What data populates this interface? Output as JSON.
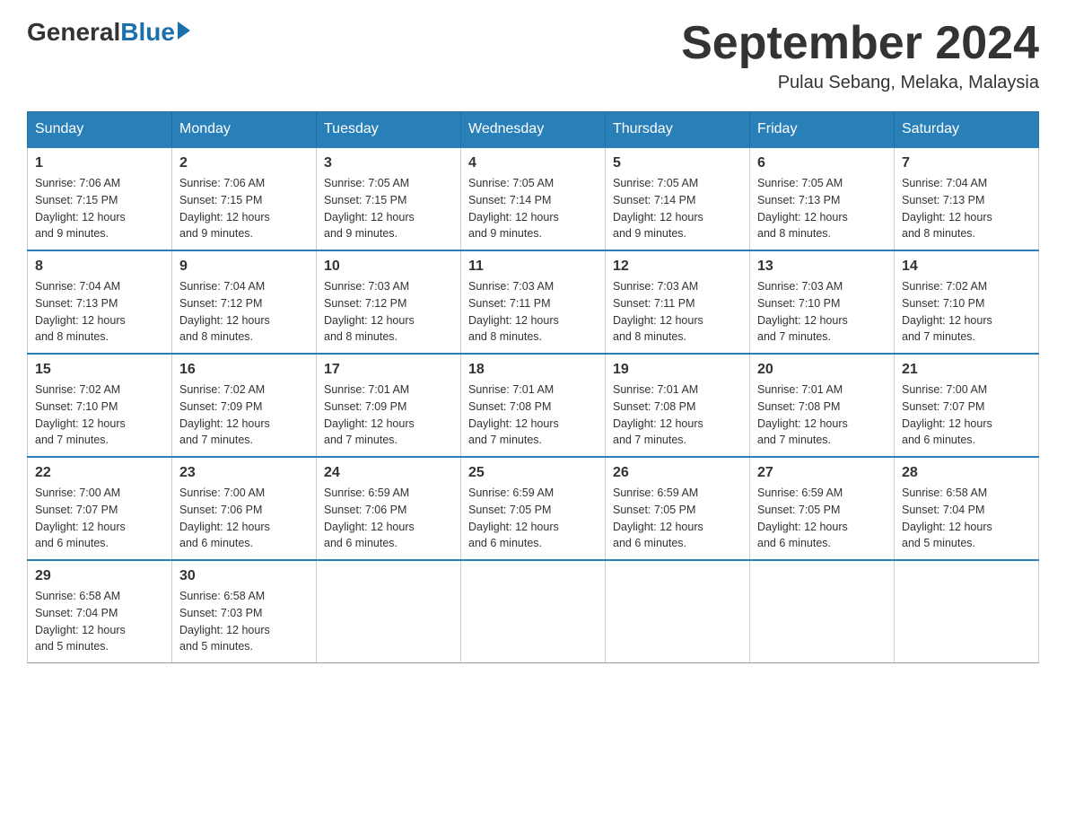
{
  "header": {
    "logo": {
      "general": "General",
      "blue": "Blue"
    },
    "title": "September 2024",
    "location": "Pulau Sebang, Melaka, Malaysia"
  },
  "days_of_week": [
    "Sunday",
    "Monday",
    "Tuesday",
    "Wednesday",
    "Thursday",
    "Friday",
    "Saturday"
  ],
  "weeks": [
    [
      {
        "day": "1",
        "sunrise": "7:06 AM",
        "sunset": "7:15 PM",
        "daylight": "12 hours and 9 minutes."
      },
      {
        "day": "2",
        "sunrise": "7:06 AM",
        "sunset": "7:15 PM",
        "daylight": "12 hours and 9 minutes."
      },
      {
        "day": "3",
        "sunrise": "7:05 AM",
        "sunset": "7:15 PM",
        "daylight": "12 hours and 9 minutes."
      },
      {
        "day": "4",
        "sunrise": "7:05 AM",
        "sunset": "7:14 PM",
        "daylight": "12 hours and 9 minutes."
      },
      {
        "day": "5",
        "sunrise": "7:05 AM",
        "sunset": "7:14 PM",
        "daylight": "12 hours and 9 minutes."
      },
      {
        "day": "6",
        "sunrise": "7:05 AM",
        "sunset": "7:13 PM",
        "daylight": "12 hours and 8 minutes."
      },
      {
        "day": "7",
        "sunrise": "7:04 AM",
        "sunset": "7:13 PM",
        "daylight": "12 hours and 8 minutes."
      }
    ],
    [
      {
        "day": "8",
        "sunrise": "7:04 AM",
        "sunset": "7:13 PM",
        "daylight": "12 hours and 8 minutes."
      },
      {
        "day": "9",
        "sunrise": "7:04 AM",
        "sunset": "7:12 PM",
        "daylight": "12 hours and 8 minutes."
      },
      {
        "day": "10",
        "sunrise": "7:03 AM",
        "sunset": "7:12 PM",
        "daylight": "12 hours and 8 minutes."
      },
      {
        "day": "11",
        "sunrise": "7:03 AM",
        "sunset": "7:11 PM",
        "daylight": "12 hours and 8 minutes."
      },
      {
        "day": "12",
        "sunrise": "7:03 AM",
        "sunset": "7:11 PM",
        "daylight": "12 hours and 8 minutes."
      },
      {
        "day": "13",
        "sunrise": "7:03 AM",
        "sunset": "7:10 PM",
        "daylight": "12 hours and 7 minutes."
      },
      {
        "day": "14",
        "sunrise": "7:02 AM",
        "sunset": "7:10 PM",
        "daylight": "12 hours and 7 minutes."
      }
    ],
    [
      {
        "day": "15",
        "sunrise": "7:02 AM",
        "sunset": "7:10 PM",
        "daylight": "12 hours and 7 minutes."
      },
      {
        "day": "16",
        "sunrise": "7:02 AM",
        "sunset": "7:09 PM",
        "daylight": "12 hours and 7 minutes."
      },
      {
        "day": "17",
        "sunrise": "7:01 AM",
        "sunset": "7:09 PM",
        "daylight": "12 hours and 7 minutes."
      },
      {
        "day": "18",
        "sunrise": "7:01 AM",
        "sunset": "7:08 PM",
        "daylight": "12 hours and 7 minutes."
      },
      {
        "day": "19",
        "sunrise": "7:01 AM",
        "sunset": "7:08 PM",
        "daylight": "12 hours and 7 minutes."
      },
      {
        "day": "20",
        "sunrise": "7:01 AM",
        "sunset": "7:08 PM",
        "daylight": "12 hours and 7 minutes."
      },
      {
        "day": "21",
        "sunrise": "7:00 AM",
        "sunset": "7:07 PM",
        "daylight": "12 hours and 6 minutes."
      }
    ],
    [
      {
        "day": "22",
        "sunrise": "7:00 AM",
        "sunset": "7:07 PM",
        "daylight": "12 hours and 6 minutes."
      },
      {
        "day": "23",
        "sunrise": "7:00 AM",
        "sunset": "7:06 PM",
        "daylight": "12 hours and 6 minutes."
      },
      {
        "day": "24",
        "sunrise": "6:59 AM",
        "sunset": "7:06 PM",
        "daylight": "12 hours and 6 minutes."
      },
      {
        "day": "25",
        "sunrise": "6:59 AM",
        "sunset": "7:05 PM",
        "daylight": "12 hours and 6 minutes."
      },
      {
        "day": "26",
        "sunrise": "6:59 AM",
        "sunset": "7:05 PM",
        "daylight": "12 hours and 6 minutes."
      },
      {
        "day": "27",
        "sunrise": "6:59 AM",
        "sunset": "7:05 PM",
        "daylight": "12 hours and 6 minutes."
      },
      {
        "day": "28",
        "sunrise": "6:58 AM",
        "sunset": "7:04 PM",
        "daylight": "12 hours and 5 minutes."
      }
    ],
    [
      {
        "day": "29",
        "sunrise": "6:58 AM",
        "sunset": "7:04 PM",
        "daylight": "12 hours and 5 minutes."
      },
      {
        "day": "30",
        "sunrise": "6:58 AM",
        "sunset": "7:03 PM",
        "daylight": "12 hours and 5 minutes."
      },
      null,
      null,
      null,
      null,
      null
    ]
  ],
  "labels": {
    "sunrise": "Sunrise:",
    "sunset": "Sunset:",
    "daylight": "Daylight:"
  }
}
